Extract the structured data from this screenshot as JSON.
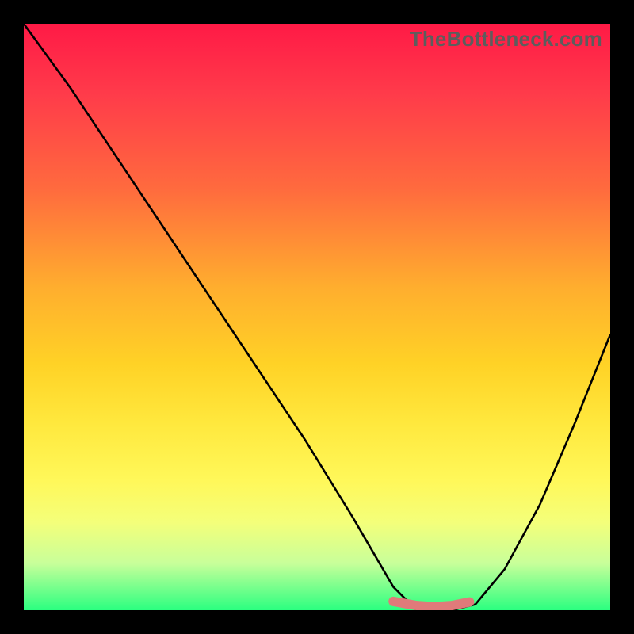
{
  "watermark": "TheBottleneck.com",
  "chart_data": {
    "type": "line",
    "title": "",
    "xlabel": "",
    "ylabel": "",
    "xlim": [
      0,
      100
    ],
    "ylim": [
      0,
      100
    ],
    "grid": false,
    "legend": false,
    "series": [
      {
        "name": "bottleneck-curve",
        "x": [
          0,
          8,
          16,
          24,
          32,
          40,
          48,
          56,
          63,
          67,
          73,
          77,
          82,
          88,
          94,
          100
        ],
        "y": [
          100,
          89,
          77,
          65,
          53,
          41,
          29,
          16,
          4,
          0,
          0,
          1,
          7,
          18,
          32,
          47
        ]
      },
      {
        "name": "optimal-band",
        "x": [
          63,
          67,
          70,
          73,
          76
        ],
        "y": [
          1.5,
          0.8,
          0.6,
          0.8,
          1.4
        ]
      }
    ],
    "background_gradient": {
      "top": "#ff1a46",
      "upper_mid": "#ffae2e",
      "mid": "#ffe83d",
      "lower_mid": "#c8ff9a",
      "bottom": "#2bff80"
    },
    "highlight_color": "#e07a7a",
    "curve_color": "#000000"
  }
}
